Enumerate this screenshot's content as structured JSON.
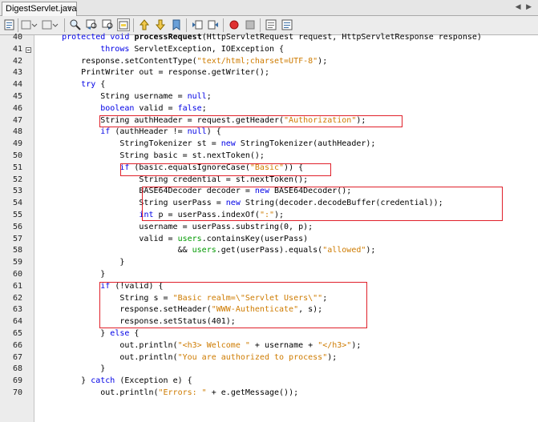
{
  "tab": {
    "label": "DigestServlet.java",
    "close_glyph": "×",
    "scroll_glyph": "◀ ▶"
  },
  "toolbar": {
    "icons": [
      "source-history-icon",
      "back-icon",
      "forward-icon",
      "find-icon",
      "find-previous-icon",
      "find-next-icon",
      "toggle-highlight-icon",
      "previous-bookmark-icon",
      "next-bookmark-icon",
      "toggle-bookmark-icon",
      "shift-left-icon",
      "shift-right-icon",
      "start-macro-icon",
      "stop-macro-icon",
      "comment-icon",
      "uncomment-icon"
    ]
  },
  "colors": {
    "keyword": "#0000e6",
    "string": "#ce7b00",
    "field": "#009900",
    "highlight_box": "#e0202a"
  },
  "code_lines": [
    {
      "num": "40",
      "text": "    protected void processRequest(HttpServletRequest request, HttpServletResponse response)"
    },
    {
      "num": "41",
      "text": "            throws ServletException, IOException {"
    },
    {
      "num": "42",
      "text": "        response.setContentType(\"text/html;charset=UTF-8\");"
    },
    {
      "num": "43",
      "text": "        PrintWriter out = response.getWriter();"
    },
    {
      "num": "44",
      "text": "        try {"
    },
    {
      "num": "45",
      "text": "            String username = null;"
    },
    {
      "num": "46",
      "text": "            boolean valid = false;"
    },
    {
      "num": "47",
      "text": "            String authHeader = request.getHeader(\"Authorization\");"
    },
    {
      "num": "48",
      "text": "            if (authHeader != null) {"
    },
    {
      "num": "49",
      "text": "                StringTokenizer st = new StringTokenizer(authHeader);"
    },
    {
      "num": "50",
      "text": "                String basic = st.nextToken();"
    },
    {
      "num": "51",
      "text": "                if (basic.equalsIgnoreCase(\"Basic\")) {"
    },
    {
      "num": "52",
      "text": "                    String credential = st.nextToken();"
    },
    {
      "num": "53",
      "text": "                    BASE64Decoder decoder = new BASE64Decoder();"
    },
    {
      "num": "54",
      "text": "                    String userPass = new String(decoder.decodeBuffer(credential));"
    },
    {
      "num": "55",
      "text": "                    int p = userPass.indexOf(\":\");"
    },
    {
      "num": "56",
      "text": "                    username = userPass.substring(0, p);"
    },
    {
      "num": "57",
      "text": "                    valid = users.containsKey(userPass)"
    },
    {
      "num": "58",
      "text": "                            && users.get(userPass).equals(\"allowed\");"
    },
    {
      "num": "59",
      "text": "                }"
    },
    {
      "num": "60",
      "text": "            }"
    },
    {
      "num": "61",
      "text": "            if (!valid) {"
    },
    {
      "num": "62",
      "text": "                String s = \"Basic realm=\\\"Servlet Users\\\"\";"
    },
    {
      "num": "63",
      "text": "                response.setHeader(\"WWW-Authenticate\", s);"
    },
    {
      "num": "64",
      "text": "                response.setStatus(401);"
    },
    {
      "num": "65",
      "text": "            } else {"
    },
    {
      "num": "66",
      "text": "                out.println(\"<h3> Welcome \" + username + \"</h3>\");"
    },
    {
      "num": "67",
      "text": "                out.println(\"You are authorized to process\");"
    },
    {
      "num": "68",
      "text": "            }"
    },
    {
      "num": "69",
      "text": "        } catch (Exception e) {"
    },
    {
      "num": "70",
      "text": "            out.println(\"Errors: \" + e.getMessage());"
    }
  ]
}
